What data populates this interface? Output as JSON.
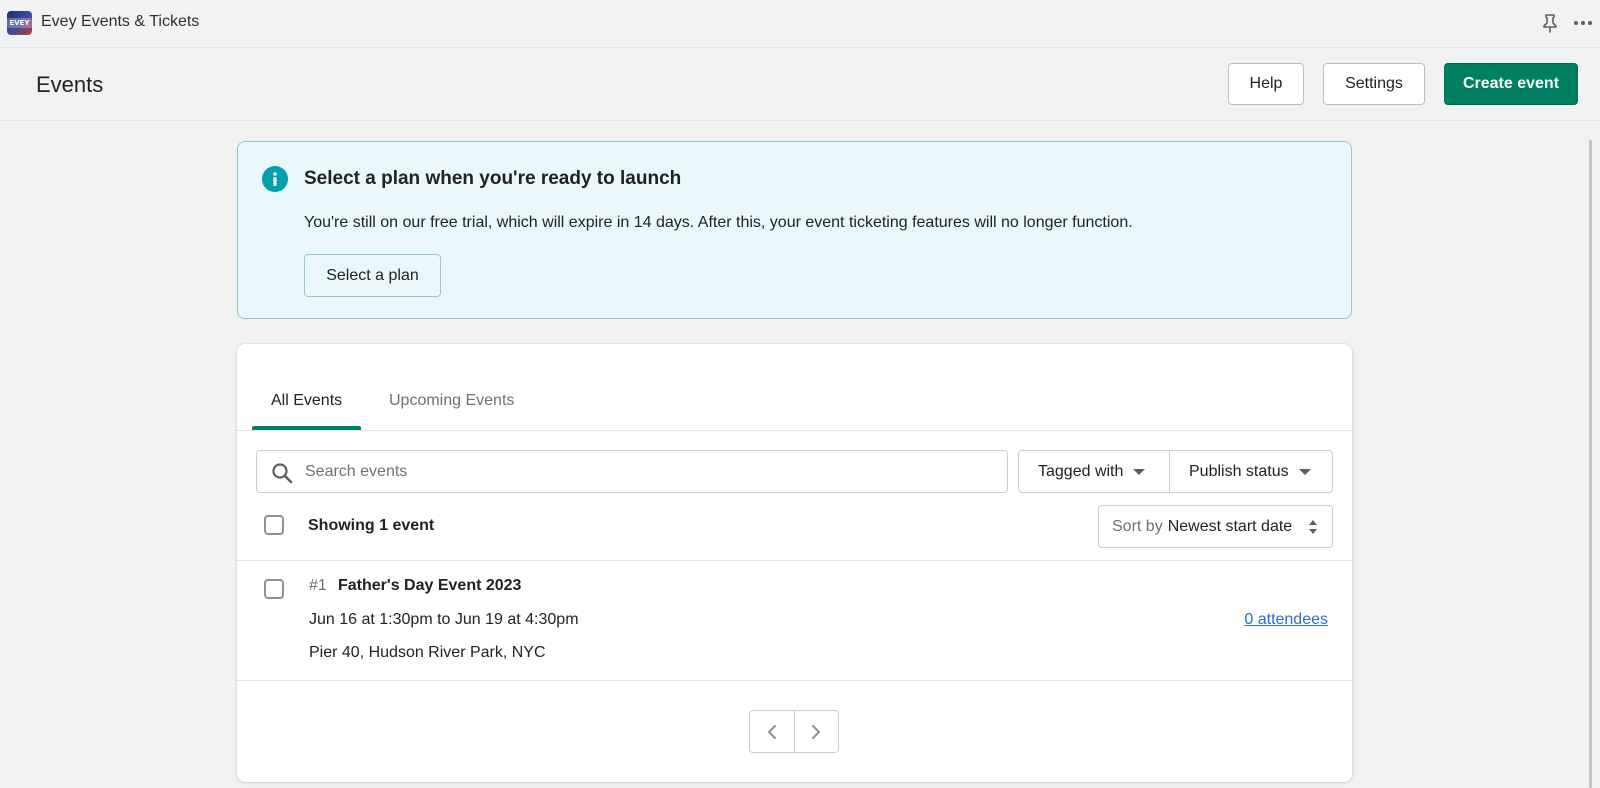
{
  "app": {
    "title": "Evey Events & Tickets",
    "logo_text": "EVEY"
  },
  "header": {
    "title": "Events",
    "help_label": "Help",
    "settings_label": "Settings",
    "create_label": "Create event"
  },
  "banner": {
    "title": "Select a plan when you're ready to launch",
    "text": "You're still on our free trial, which will expire in 14 days. After this, your event ticketing features will no longer function.",
    "button_label": "Select a plan"
  },
  "tabs": [
    {
      "label": "All Events",
      "selected": true
    },
    {
      "label": "Upcoming Events",
      "selected": false
    }
  ],
  "filters": {
    "search_placeholder": "Search events",
    "tagged_label": "Tagged with",
    "publish_label": "Publish status"
  },
  "list": {
    "showing_label": "Showing 1 event",
    "sort_label": "Sort by",
    "sort_value": "Newest start date"
  },
  "events": [
    {
      "number": "#1",
      "name": "Father's Day Event 2023",
      "dates": "Jun 16 at 1:30pm to Jun 19 at 4:30pm",
      "location": "Pier 40, Hudson River Park, NYC",
      "attendees": "0 attendees"
    }
  ],
  "colors": {
    "primary": "#008060",
    "banner_bg": "#eaf8fc",
    "info": "#00a0ac",
    "link": "#2c6ecb"
  }
}
